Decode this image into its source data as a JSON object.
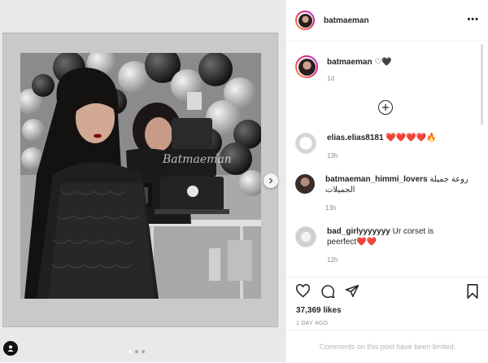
{
  "post": {
    "username": "batmaeman",
    "caption_user": "batmaeman",
    "caption_text": "♡🖤",
    "caption_time": "1d",
    "likes": "37,369 likes",
    "posted_ago": "1 DAY AGO",
    "limited_notice": "Comments on this post have been limited.",
    "carousel_count": 3,
    "carousel_active": 1
  },
  "icons": {
    "more": "more-options-icon",
    "like": "heart-icon",
    "comment": "comment-icon",
    "share": "paper-plane-icon",
    "save": "bookmark-icon",
    "load_more": "plus-circle-icon",
    "next": "chevron-right-icon"
  },
  "comments": [
    {
      "user": "elias.elias8181",
      "text": "❤️❤️❤️❤️🔥",
      "time": "13h"
    },
    {
      "user": "batmaeman_himmi_lovers",
      "text": "روعة جميلة الجميلات",
      "time": "13h"
    },
    {
      "user": "bad_girlyyyyyyy",
      "text": "Ur corset is peerfect❤️❤️",
      "time": "12h"
    }
  ],
  "photo_cake_text": "Batmaeman"
}
